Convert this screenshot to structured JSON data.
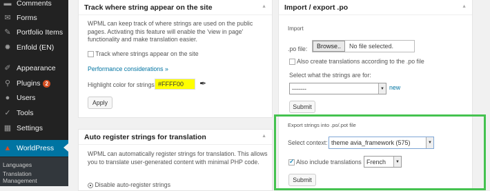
{
  "sidebar": {
    "items": [
      {
        "label": "Comments",
        "icon": "comment-icon"
      },
      {
        "label": "Forms",
        "icon": "forms-icon"
      },
      {
        "label": "Portfolio Items",
        "icon": "portfolio-icon"
      },
      {
        "label": "Enfold (EN)",
        "icon": "gear-icon"
      },
      {
        "label": "Appearance",
        "icon": "brush-icon"
      },
      {
        "label": "Plugins",
        "icon": "plug-icon",
        "badge": "2"
      },
      {
        "label": "Users",
        "icon": "user-icon"
      },
      {
        "label": "Tools",
        "icon": "wrench-icon"
      },
      {
        "label": "Settings",
        "icon": "settings-icon"
      },
      {
        "label": "WorldPress",
        "icon": "wpml-icon"
      }
    ],
    "submenu": [
      "Languages",
      "Translation",
      "Management"
    ]
  },
  "track_box": {
    "title": "Track where string appear on the site",
    "description": "WPML can keep track of where strings are used on the public pages. Activating this feature will enable the 'view in page' functionality and make translation easier.",
    "checkbox_label": "Track where strings appear on the site",
    "link": "Performance considerations »",
    "highlight_label": "Highlight color for strings",
    "highlight_value": "#FFFF00",
    "apply": "Apply"
  },
  "auto_box": {
    "title": "Auto register strings for translation",
    "description": "WPML can automatically register strings for translation. This allows you to translate user-generated content with minimal PHP code.",
    "radio_label": "Disable auto-register strings"
  },
  "import_box": {
    "title": "Import / export .po",
    "import_heading": "Import",
    "po_file_label": ".po file:",
    "browse": "Browse..",
    "no_file": "No file selected.",
    "create_label": "Also create translations according to the .po file",
    "strings_for_label": "Select what the strings are for:",
    "select_value": "-------",
    "new_link": "new",
    "submit": "Submit",
    "export_heading": "Export strings into .po/.pot file",
    "context_label": "Select context:",
    "context_value": "theme avia_framework (575)",
    "include_label": "Also include translations",
    "language": "French",
    "submit2": "Submit",
    "highlight_color": "#44c24f"
  }
}
